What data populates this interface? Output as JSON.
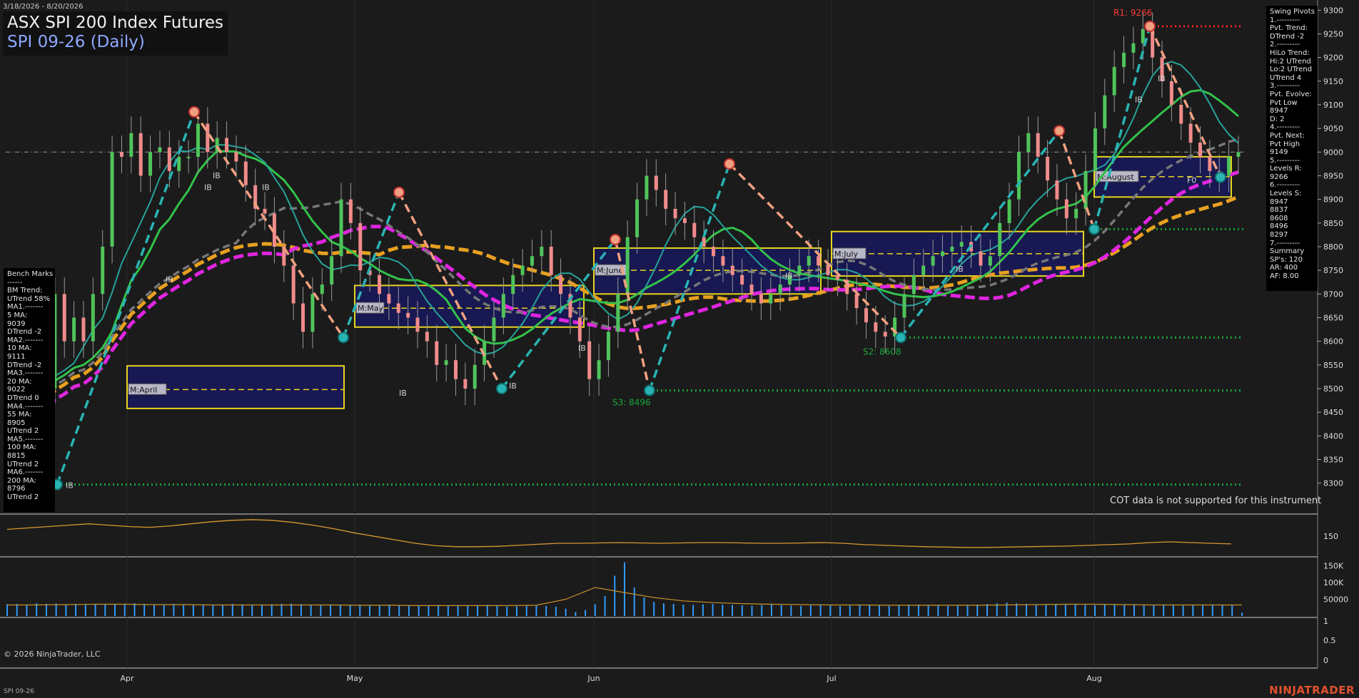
{
  "header": {
    "date_range": "3/18/2026 - 8/20/2026",
    "title": "ASX SPI 200 Index Futures",
    "subtitle": "SPI 09-26 (Daily)"
  },
  "footer": {
    "copyright": "© 2026 NinjaTrader, LLC",
    "instrument": "SPI 09-26",
    "brand": "NINJATRADER",
    "cot_note": "COT data is not supported for this instrument"
  },
  "bench_marks": {
    "title": "Bench Marks",
    "lines": [
      "------",
      "BM Trend:",
      "UTrend 58%",
      "MA1.-------",
      "5 MA:",
      "9039",
      "DTrend -2",
      "MA2.-------",
      "10 MA:",
      "9111",
      "DTrend -2",
      "MA3.-------",
      "20 MA:",
      "9022",
      "DTrend 0",
      "MA4.-------",
      "55 MA:",
      "8905",
      "UTrend 2",
      "MA5.-------",
      "100 MA:",
      "8815",
      "UTrend 2",
      "MA6.-------",
      "200 MA:",
      "8796",
      "UTrend 2"
    ]
  },
  "swing_pivots": {
    "title": "Swing Pivots",
    "lines": [
      "1.---------",
      "Pvt. Trend:",
      "DTrend -2",
      "2.---------",
      "HiLo Trend:",
      "Hi:2 UTrend",
      "Lo:2 UTrend",
      "UTrend 4",
      "3.---------",
      "Pvt. Evolve:",
      "Pvt Low",
      "8947",
      "D: 2",
      "4.---------",
      "Pvt. Next:",
      "Pvt High",
      "9149",
      "5.---------",
      "Levels R:",
      "9266",
      "6.---------",
      "Levels S:",
      "8947",
      "8837",
      "8608",
      "8496",
      "8297",
      "7.---------",
      "Summary",
      "SP's: 120",
      "AR: 400",
      "AF: 8.00"
    ]
  },
  "chart_data": [
    {
      "type": "candlestick",
      "title": "ASX SPI 200 Index Futures",
      "subtitle": "SPI 09-26 (Daily)",
      "x_labels": [
        "Apr",
        "May",
        "Jun",
        "Jul",
        "Aug"
      ],
      "y_ticks": [
        8300,
        8350,
        8400,
        8450,
        8500,
        8550,
        8600,
        8650,
        8700,
        8750,
        8800,
        8850,
        8900,
        8950,
        9000,
        9050,
        9100,
        9150,
        9200,
        9250,
        9300
      ],
      "ylim": [
        8270,
        9320
      ],
      "close_estimate": [
        8320,
        8420,
        8600,
        8560,
        8500,
        8700,
        8600,
        8650,
        8600,
        8700,
        8800,
        9000,
        8990,
        9040,
        8950,
        9000,
        9010,
        8960,
        8990,
        8990,
        9060,
        9000,
        9030,
        9000,
        8980,
        8930,
        8880,
        8870,
        8800,
        8760,
        8680,
        8620,
        8700,
        8720,
        8780,
        8900,
        8850,
        8750,
        8740,
        8700,
        8680,
        8660,
        8650,
        8620,
        8600,
        8550,
        8560,
        8520,
        8500,
        8550,
        8600,
        8650,
        8700,
        8740,
        8760,
        8780,
        8800,
        8740,
        8700,
        8650,
        8600,
        8520,
        8560,
        8620,
        8700,
        8820,
        8900,
        8950,
        8920,
        8880,
        8860,
        8850,
        8820,
        8800,
        8780,
        8760,
        8740,
        8720,
        8700,
        8680,
        8700,
        8720,
        8740,
        8760,
        8780,
        8760,
        8740,
        8730,
        8700,
        8670,
        8640,
        8620,
        8610,
        8650,
        8700,
        8740,
        8760,
        8780,
        8790,
        8800,
        8810,
        8790,
        8760,
        8780,
        8850,
        8900,
        9000,
        9040,
        8990,
        8940,
        8900,
        8860,
        8880,
        8960,
        9050,
        9120,
        9180,
        9210,
        9230,
        9260,
        9200,
        9150,
        9100,
        9060,
        9020,
        8990,
        8960,
        8950,
        8990,
        9000
      ],
      "swing_points": [
        {
          "label": "IB",
          "value": 8297,
          "type": "low"
        },
        {
          "value": 9085,
          "type": "high"
        },
        {
          "value": 8608,
          "type": "low"
        },
        {
          "value": 8915,
          "type": "high"
        },
        {
          "label": "IB",
          "value": 8500,
          "type": "low"
        },
        {
          "value": 8815,
          "type": "high"
        },
        {
          "value": 8496,
          "type": "low"
        },
        {
          "value": 8975,
          "type": "high"
        },
        {
          "value": 8608,
          "type": "low"
        },
        {
          "value": 9045,
          "type": "high"
        },
        {
          "value": 8837,
          "type": "low"
        },
        {
          "value": 9266,
          "type": "high"
        },
        {
          "value": 8947,
          "type": "low"
        }
      ],
      "levels": [
        {
          "label": "R1: 9266",
          "value": 9266,
          "color": "#ff2222"
        },
        {
          "label": "S2: 8608",
          "value": 8608,
          "color": "#19a63a"
        },
        {
          "label": "S3: 8496",
          "value": 8496,
          "color": "#19a63a"
        },
        {
          "value": 8837,
          "color": "#19a63a"
        },
        {
          "value": 8297,
          "color": "#19a63a"
        }
      ],
      "value_areas": [
        {
          "label": "M:April",
          "low": 8458,
          "high": 8548,
          "mid": 8498
        },
        {
          "label": "M:May",
          "low": 8630,
          "high": 8718,
          "mid": 8670
        },
        {
          "label": "M:June",
          "low": 8700,
          "high": 8797,
          "mid": 8750
        },
        {
          "label": "M:July",
          "low": 8738,
          "high": 8832,
          "mid": 8785
        },
        {
          "label": "M:August",
          "low": 8905,
          "high": 8990,
          "mid": 8948
        }
      ],
      "moving_averages": [
        {
          "name": "5 MA",
          "value": 9039,
          "trend": "DTrend -2"
        },
        {
          "name": "10 MA",
          "value": 9111,
          "trend": "DTrend -2"
        },
        {
          "name": "20 MA",
          "value": 9022,
          "trend": "DTrend 0"
        },
        {
          "name": "55 MA",
          "value": 8905,
          "trend": "UTrend 2"
        },
        {
          "name": "100 MA",
          "value": 8815,
          "trend": "UTrend 2"
        },
        {
          "name": "200 MA",
          "value": 8796,
          "trend": "UTrend 2"
        }
      ],
      "markers": [
        "IB",
        "IB",
        "IB",
        "IB",
        "IB",
        "IB",
        "IB",
        "IB",
        "IB",
        "IB",
        "IB",
        "IB",
        "F0"
      ],
      "reference_line": 9000
    },
    {
      "type": "line",
      "name": "oscillator",
      "y_ticks": [
        150
      ],
      "ylim": [
        95,
        210
      ],
      "values": [
        170,
        174,
        178,
        182,
        186,
        182,
        178,
        176,
        180,
        186,
        192,
        196,
        198,
        196,
        190,
        182,
        172,
        160,
        150,
        140,
        130,
        123,
        120,
        120,
        121,
        124,
        127,
        130,
        130,
        131,
        132,
        131,
        130,
        131,
        132,
        132,
        131,
        130,
        130,
        131,
        132,
        130,
        126,
        124,
        122,
        120,
        119,
        118,
        118,
        119,
        120,
        121,
        122,
        124,
        126,
        128,
        132,
        134,
        132,
        130,
        128
      ]
    },
    {
      "type": "bar",
      "name": "volume",
      "y_ticks": [
        "150K",
        "100K",
        "50000"
      ],
      "ylim": [
        0,
        170000
      ],
      "values": [
        35000,
        36000,
        34000,
        38000,
        36000,
        37000,
        35000,
        36000,
        33000,
        34000,
        35000,
        36000,
        37000,
        38000,
        36000,
        35000,
        34000,
        36000,
        35000,
        34000,
        33000,
        32000,
        34000,
        36000,
        35000,
        34000,
        33000,
        35000,
        36000,
        37000,
        35000,
        34000,
        33000,
        32000,
        34000,
        33000,
        32000,
        31000,
        33000,
        34000,
        32000,
        31000,
        30000,
        32000,
        33000,
        31000,
        30000,
        31000,
        32000,
        33000,
        30000,
        28000,
        29000,
        30000,
        31000,
        30000,
        28000,
        22000,
        12000,
        18000,
        35000,
        60000,
        120000,
        160000,
        85000,
        55000,
        42000,
        38000,
        36000,
        34000,
        33000,
        35000,
        36000,
        34000,
        33000,
        32000,
        31000,
        33000,
        34000,
        32000,
        31000,
        30000,
        32000,
        33000,
        31000,
        30000,
        31000,
        32000,
        33000,
        31000,
        30000,
        32000,
        33000,
        34000,
        32000,
        31000,
        30000,
        32000,
        33000,
        34000,
        36000,
        38000,
        40000,
        38000,
        36000,
        34000,
        33000,
        35000,
        36000,
        34000,
        33000,
        32000,
        34000,
        35000,
        34000,
        33000,
        32000,
        33000,
        34000,
        32000,
        31000,
        33000,
        34000,
        32000,
        34000,
        33000,
        10000
      ],
      "avg_line": [
        33000,
        33000,
        34000,
        35000,
        35000,
        34000,
        34000,
        33000,
        33000,
        33000,
        33000,
        33000,
        32000,
        32000,
        31000,
        31000,
        31000,
        31000,
        32000,
        50000,
        85000,
        70000,
        55000,
        45000,
        40000,
        37000,
        35000,
        34000,
        33000,
        33000,
        32000,
        32000,
        32000,
        32000,
        33000,
        34000,
        35000,
        35000,
        34000,
        33000,
        33000,
        33000,
        33000
      ]
    },
    {
      "type": "line",
      "name": "lower-panel",
      "y_ticks": [
        "1",
        "0.5",
        "0"
      ],
      "ylim": [
        -0.05,
        1.05
      ],
      "values": []
    }
  ]
}
